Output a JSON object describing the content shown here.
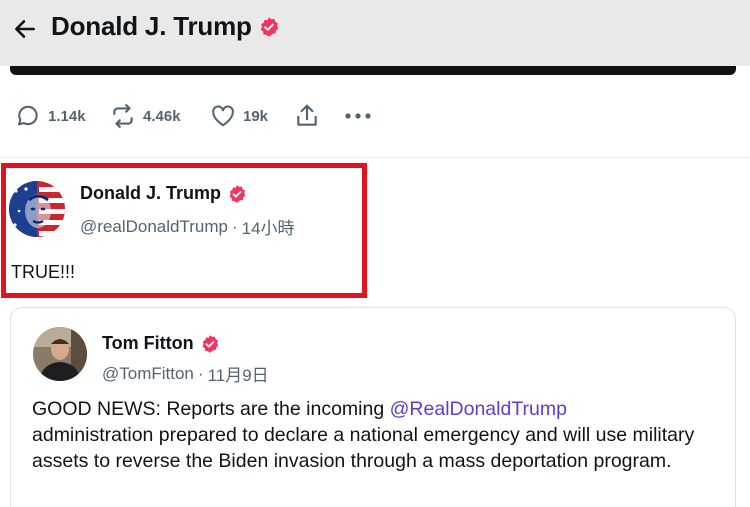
{
  "header": {
    "title": "Donald J. Trump",
    "back_icon": "arrow-left-icon"
  },
  "actions": {
    "reply_count": "1.14k",
    "retweet_count": "4.46k",
    "like_count": "19k"
  },
  "post": {
    "name": "Donald J. Trump",
    "handle": "@realDonaldTrump",
    "separator": "·",
    "time": "14小時",
    "text": "TRUE!!!"
  },
  "quote": {
    "name": "Tom Fitton",
    "handle": "@TomFitton",
    "separator": "·",
    "time": "11月9日",
    "text_before": "GOOD NEWS: Reports are the incoming ",
    "mention": "@RealDonaldTrump",
    "text_after": " administration prepared to declare a national emergency and will use military assets to reverse the Biden invasion through a mass deportation program."
  },
  "colors": {
    "verified_badge": "#f2345f",
    "highlight_border": "#e0131f",
    "mention": "#5b3fd0",
    "secondary_text": "#536471"
  }
}
